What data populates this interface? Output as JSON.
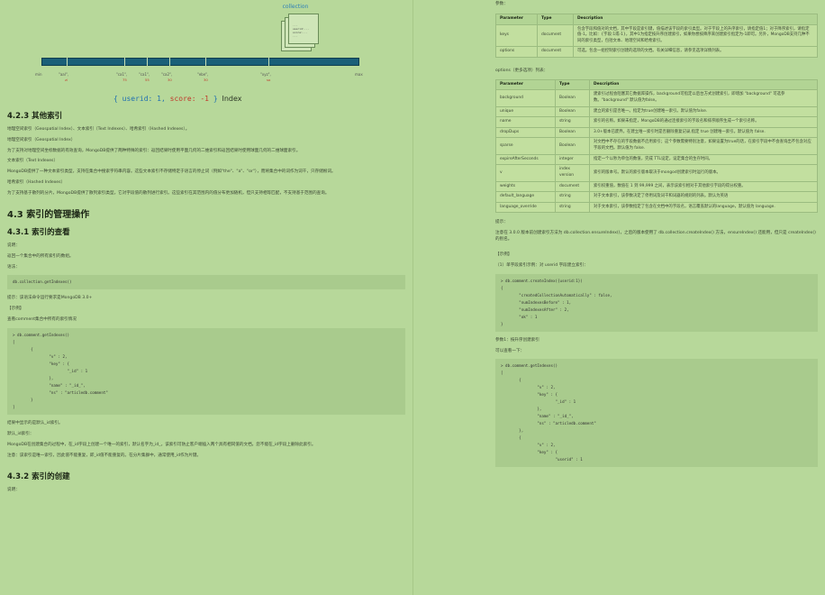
{
  "left": {
    "figure": {
      "collection_label": "collection",
      "doc_lines": [
        "...",
        "userid:...",
        "score:...",
        "..."
      ],
      "keys": [
        {
          "key": "min",
          "val": ""
        },
        {
          "key": "\"aal\",",
          "val": "zi"
        },
        {
          "key": "\"ca1\",",
          "val": "75"
        },
        {
          "key": "\"ca1\",",
          "val": "55"
        },
        {
          "key": "\"ca2\",",
          "val": "30"
        },
        {
          "key": "\"ebe\",",
          "val": "30"
        },
        {
          "key": "\"xyz\",",
          "val": "so"
        },
        {
          "key": "max",
          "val": ""
        }
      ],
      "index_open": "{ userid: 1,",
      "index_score": "score: -1",
      "index_close": "}",
      "index_word": "Index"
    },
    "s423_title": "4.2.3 其他索引",
    "s423_p1": "地理空间索引（Geospatial Index）、文本索引（Text Indexes）、哈希索引（Hashed Indexes）。",
    "geo_title": "地理空间索引（Geospatial Index）",
    "geo_p": "为了支持对地理空间坐标数据的有效查询，MongoDB提供了两种特殊的索引：返回结果时使用平面几何的二维索引和返回结果时使用球面几何的二维球面索引。",
    "text_title": "文本索引（Text Indexes）",
    "text_p": "MongoDB提供了一种文本索引类型，支持在集合中搜索字符串内容。这些文本索引不存储特定于语言的停止词（例如\"the\"、\"a\"、\"or\"），而将集合中的词作为词干，只存储根词。",
    "hash_title": "哈希索引（Hashed Indexes）",
    "hash_p": "为了支持基于散列的分片，MongoDB提供了散列索引类型，它对字段值的散列进行索引。这些索引在其范围内的值分布更加随机，但只支持相等匹配，不支持基于范围的查询。",
    "s43_title": "4.3 索引的管理操作",
    "s431_title": "4.3.1 索引的查看",
    "desc_label": "说明：",
    "desc_text": "返回一个集合中的所有索引的数组。",
    "syntax_label": "语法：",
    "code1": "db.collection.getIndexes()",
    "tip": "提示：该语法命令运行要求是MongoDB 3.0+",
    "example_label": "【示例】",
    "example_text": "查看comment集合中所有的索引情况",
    "code2_lines": [
      "> db.comment.getIndexes()",
      "[",
      "        {",
      "                \"v\" : 2,",
      "                \"key\" : {",
      "                        \"_id\" : 1",
      "                },",
      "                \"name\" : \"_id_\",",
      "                \"ns\" : \"articledb.comment\"",
      "        }",
      "]"
    ],
    "result_p": "结果中显示的是默认_id索引。",
    "default_label": "默认_id索引：",
    "default_p": "MongoDB在创建集合的过程中，在_id字段上创建一个唯一的索引，默认名字为_id_，该索引可防止客户端插入两个具有相同值的文档，您不能在_id字段上删除此索引。",
    "note_p": "注意：该索引是唯一索引，因此值不能重复，即_id值不能重复的。在分片集群中，通常使用_id作为片键。",
    "s432_title": "4.3.2 索引的创建",
    "s432_desc": "说明："
  },
  "right": {
    "params_label": "参数：",
    "t1_headers": [
      "Parameter",
      "Type",
      "Description"
    ],
    "t1_rows": [
      [
        "keys",
        "document",
        "包含字段和值对的文档，其中字段是索引键，值描述该字段的索引类型。对于字段上的升序索引，请指定值1；对于降序索引，请指定值-1。比如：{字段:1或-1}，其中1为指定按升序创建索引，如果你想按降序来创建索引指定为-1即可。另外，MongoDB支持几种不同的索引类型，包括文本、地理空间和哈希索引。"
      ],
      [
        "options",
        "document",
        "可选。包含一组控制索引创建的选项的文档。有关详细信息，请参见选项详情列表。"
      ]
    ],
    "options_label": "options（更多选项）列表：",
    "t2_headers": [
      "Parameter",
      "Type",
      "Description"
    ],
    "t2_rows": [
      [
        "background",
        "Boolean",
        "建索引过程会阻塞其它数据库操作，background可指定以后台方式创建索引，即增加 \"background\" 可选参数。\"background\" 默认值为false。"
      ],
      [
        "unique",
        "Boolean",
        "建立的索引是否唯一。指定为true创建唯一索引。默认值为false."
      ],
      [
        "name",
        "string",
        "索引的名称。如果未指定，MongoDB的通过连接索引的字段名和排序顺序生成一个索引名称。"
      ],
      [
        "dropDups",
        "Boolean",
        "3.0+版本已废弃。在建立唯一索引时是否删除重复记录,指定 true 创建唯一索引。默认值为 false."
      ],
      [
        "sparse",
        "Boolean",
        "对文档中不存在的字段数据不启用索引；这个参数需要特别注意，如果设置为true的话，在索引字段中不会查询出不包含对应字段的文档。默认值为 false."
      ],
      [
        "expireAfterSeconds",
        "integer",
        "指定一个以秒为单位的数值，完成 TTL设定，设定集合的生存时间。"
      ],
      [
        "v",
        "index version",
        "索引的版本号。默认的索引版本取决于mongod创建索引时运行的版本。"
      ],
      [
        "weights",
        "document",
        "索引权重值，数值在 1 到 99,999 之间，表示该索引相对于其他索引字段的得分权重。"
      ],
      [
        "default_language",
        "string",
        "对于文本索引，该参数决定了停用词及词干和词器的规则的列表。默认为英语"
      ],
      [
        "language_override",
        "string",
        "对于文本索引，该参数指定了包含在文档中的字段名，语言覆盖默认的language，默认值为 language."
      ]
    ],
    "tip_label": "提示：",
    "tip_p": "注意在 3.0.0 版本前创建索引方法为 db.collection.ensureIndex()，之后的版本使用了 db.collection.createIndex() 方法，ensureIndex() 还能用，但只是 createIndex() 的别名。",
    "example_label": "【示例】",
    "ex1_title": "（1）单字段索引示例：对 userid 字段建立索引：",
    "code3_lines": [
      "> db.comment.createIndex({userid:1})",
      "{",
      "        \"createdCollectionAutomatically\" : false,",
      "        \"numIndexesBefore\" : 1,",
      "        \"numIndexesAfter\" : 2,",
      "        \"ok\" : 1",
      "}"
    ],
    "ex1_param": "参数1：按升序创建索引",
    "ex1_view": "可以查看一下：",
    "code4_lines": [
      "> db.comment.getIndexes()",
      "[",
      "        {",
      "                \"v\" : 2,",
      "                \"key\" : {",
      "                        \"_id\" : 1",
      "                },",
      "                \"name\" : \"_id_\",",
      "                \"ns\" : \"articledb.comment\"",
      "        },",
      "        {",
      "                \"v\" : 2,",
      "                \"key\" : {",
      "                        \"userid\" : 1"
    ]
  }
}
